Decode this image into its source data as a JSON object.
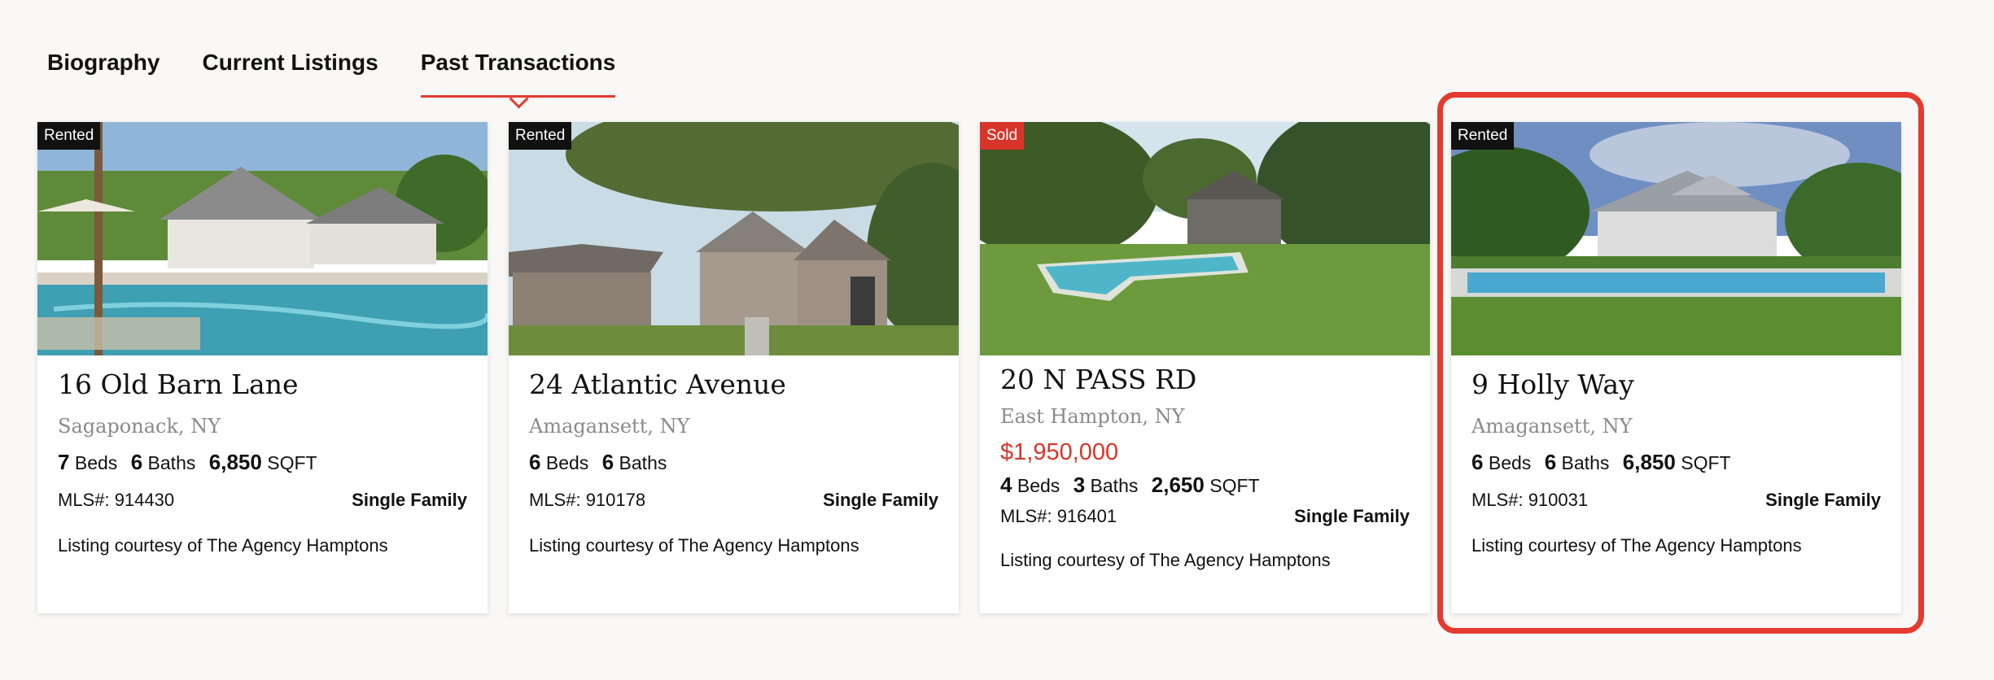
{
  "tabs": [
    {
      "label": "Biography",
      "active": false
    },
    {
      "label": "Current Listings",
      "active": false
    },
    {
      "label": "Past Transactions",
      "active": true
    }
  ],
  "listings": [
    {
      "badge": "Rented",
      "address": "16 Old Barn Lane",
      "city": "Sagaponack, NY",
      "price": "",
      "beds": "7",
      "beds_label": "Beds",
      "baths": "6",
      "baths_label": "Baths",
      "sqft": "6,850",
      "sqft_label": "SQFT",
      "mls": "MLS#: 914430",
      "type": "Single Family",
      "courtesy": "Listing courtesy of The Agency Hamptons"
    },
    {
      "badge": "Rented",
      "address": "24 Atlantic Avenue",
      "city": "Amagansett, NY",
      "price": "",
      "beds": "6",
      "beds_label": "Beds",
      "baths": "6",
      "baths_label": "Baths",
      "sqft": "",
      "sqft_label": "",
      "mls": "MLS#: 910178",
      "type": "Single Family",
      "courtesy": "Listing courtesy of The Agency Hamptons"
    },
    {
      "badge": "Sold",
      "address": "20 N PASS RD",
      "city": "East Hampton, NY",
      "price": "$1,950,000",
      "beds": "4",
      "beds_label": "Beds",
      "baths": "3",
      "baths_label": "Baths",
      "sqft": "2,650",
      "sqft_label": "SQFT",
      "mls": "MLS#: 916401",
      "type": "Single Family",
      "courtesy": "Listing courtesy of The Agency Hamptons"
    },
    {
      "badge": "Rented",
      "address": "9 Holly Way",
      "city": "Amagansett, NY",
      "price": "",
      "beds": "6",
      "beds_label": "Beds",
      "baths": "6",
      "baths_label": "Baths",
      "sqft": "6,850",
      "sqft_label": "SQFT",
      "mls": "MLS#: 910031",
      "type": "Single Family",
      "courtesy": "Listing courtesy of The Agency Hamptons"
    }
  ],
  "colors": {
    "accent": "#e23b30",
    "sold_badge": "#d8352a",
    "highlight": "#e33b2e"
  }
}
